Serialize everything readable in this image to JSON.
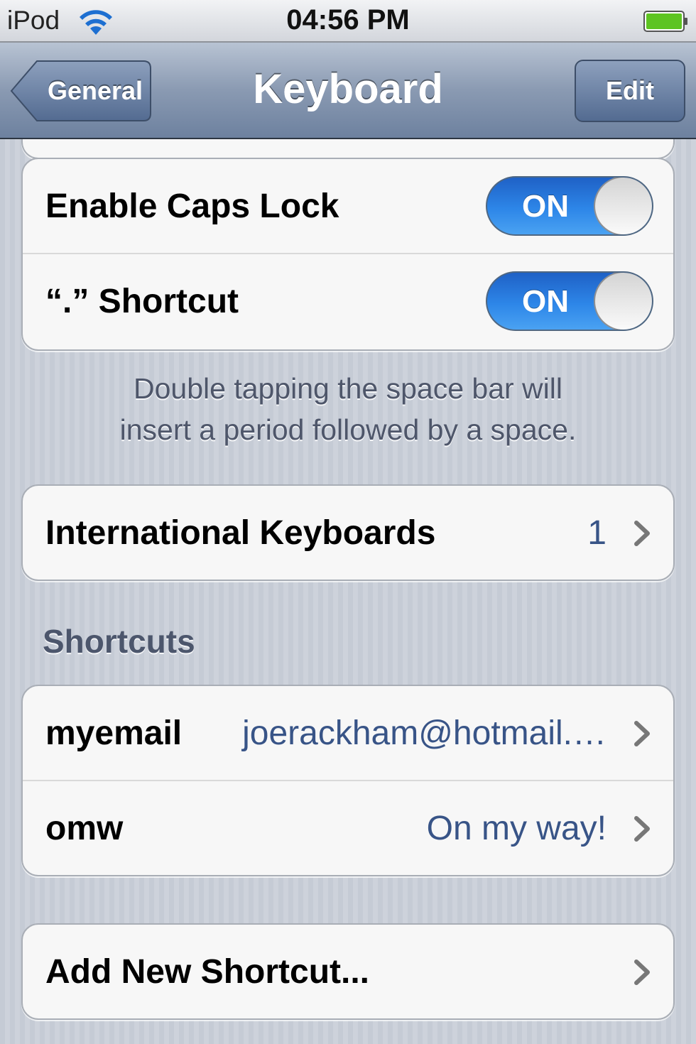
{
  "status_bar": {
    "carrier": "iPod",
    "time": "04:56 PM",
    "wifi_icon": "wifi-icon",
    "battery_icon": "battery-icon",
    "battery_color": "#5ec422"
  },
  "nav": {
    "back_label": "General",
    "title": "Keyboard",
    "edit_label": "Edit"
  },
  "toggles_group": {
    "rows": [
      {
        "label": "Enable Caps Lock",
        "state": "ON"
      },
      {
        "label": "“.” Shortcut",
        "state": "ON"
      }
    ]
  },
  "period_note": {
    "line1": "Double tapping the space bar will",
    "line2": "insert a period followed by a space."
  },
  "international": {
    "label": "International Keyboards",
    "count": "1"
  },
  "shortcuts": {
    "header": "Shortcuts",
    "items": [
      {
        "phrase": "myemail",
        "expansion": "joerackham@hotmail.…"
      },
      {
        "phrase": "omw",
        "expansion": "On my way!"
      }
    ]
  },
  "add_shortcut": {
    "label": "Add New Shortcut..."
  },
  "colors": {
    "toggle_on": "#2d86e8",
    "detail_text": "#385487",
    "nav_bar": "#8a9ab2"
  }
}
